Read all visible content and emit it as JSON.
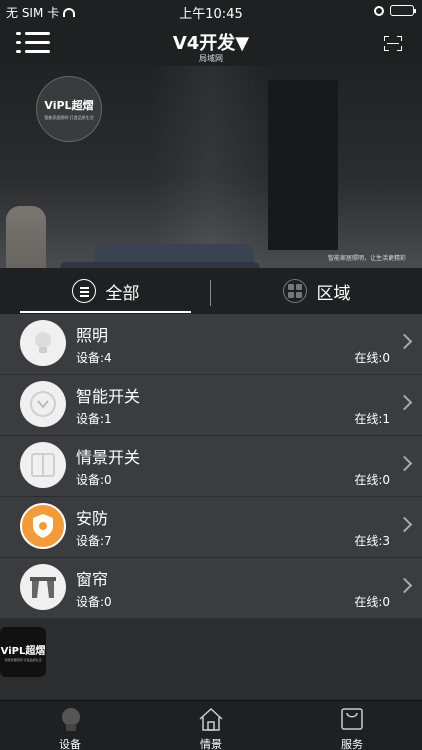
{
  "status_bar": {
    "carrier": "无 SIM 卡",
    "time": "上午10:45",
    "battery_level": 0.85
  },
  "nav": {
    "title": "V4开发▼",
    "subtitle": "局域网"
  },
  "banner": {
    "brand": "ViPL超熠",
    "tagline": "智能家居照明 打造品质生活",
    "caption": "智能家居照明，让生活更精彩"
  },
  "segment": {
    "all_label": "全部",
    "area_label": "区域"
  },
  "devices": [
    {
      "name": "照明",
      "count_label": "设备:4",
      "online_label": "在线:0",
      "icon": "bulb-icon"
    },
    {
      "name": "智能开关",
      "count_label": "设备:1",
      "online_label": "在线:1",
      "icon": "power-switch-icon"
    },
    {
      "name": "情景开关",
      "count_label": "设备:0",
      "online_label": "在线:0",
      "icon": "scene-switch-icon"
    },
    {
      "name": "安防",
      "count_label": "设备:7",
      "online_label": "在线:3",
      "icon": "shield-icon"
    },
    {
      "name": "窗帘",
      "count_label": "设备:0",
      "online_label": "在线:0",
      "icon": "curtain-icon"
    }
  ],
  "float_logo": {
    "brand": "ViPL超熠",
    "tagline": "智能家居照明 打造品质生活"
  },
  "tabs": [
    {
      "label": "设备",
      "icon": "bulb-icon"
    },
    {
      "label": "情景",
      "icon": "home-icon"
    },
    {
      "label": "服务",
      "icon": "bag-icon"
    }
  ],
  "colors": {
    "accent": "#f39a3a",
    "row_bg": "#3a3c3f",
    "bar_bg": "#1f2022"
  }
}
